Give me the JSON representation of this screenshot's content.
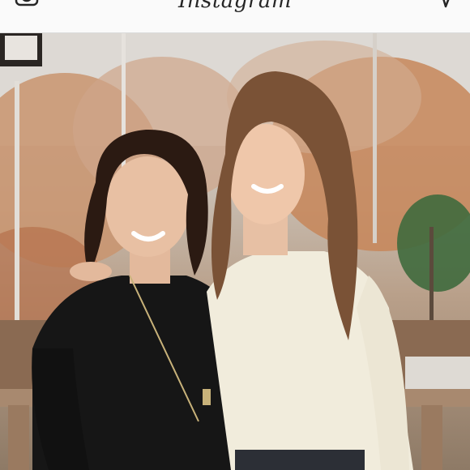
{
  "header": {
    "brand_text": "Instagram",
    "left_icon": "camera-icon",
    "right_icon": "direct-message-icon"
  },
  "post": {
    "image_description_icon": "photo",
    "colors": {
      "sky": "#d9d6d2",
      "foliage": "#c98a5c",
      "deck": "#a0826a",
      "black_top": "#151515",
      "cream_sweater": "#f3eedf"
    }
  }
}
